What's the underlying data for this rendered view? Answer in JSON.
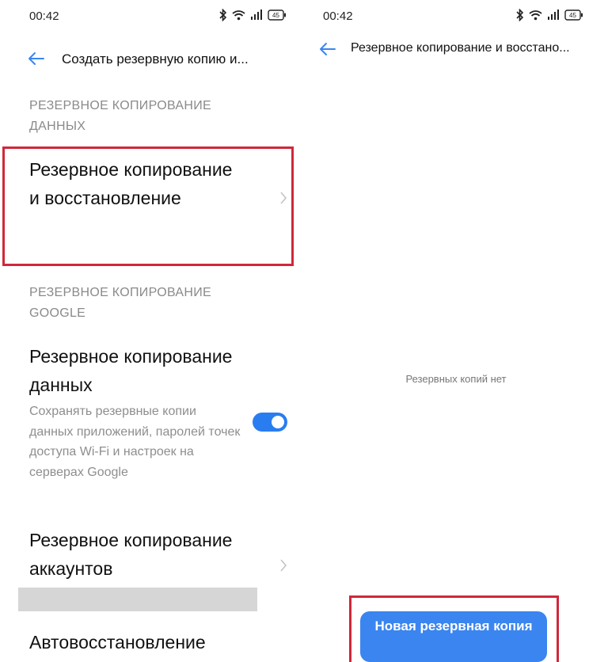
{
  "left_screen": {
    "status": {
      "time": "00:42",
      "battery": "45"
    },
    "title": "Создать резервную копию и...",
    "sections": [
      {
        "header": "РЕЗЕРВНОЕ КОПИРОВАНИЕ ДАННЫХ",
        "items": [
          {
            "title": "Резервное копирование и восстановление"
          }
        ]
      },
      {
        "header": "РЕЗЕРВНОЕ КОПИРОВАНИЕ GOOGLE",
        "items": [
          {
            "title": "Резервное копирование данных",
            "subtitle": "Сохранять резервные копии данных приложений, паролей точек доступа Wi-Fi и настроек на серверах Google",
            "toggle": true
          },
          {
            "title": "Резервное копирование аккаунтов"
          },
          {
            "title": "Автовосстановление"
          }
        ]
      }
    ]
  },
  "right_screen": {
    "status": {
      "time": "00:42",
      "battery": "45"
    },
    "title": "Резервное копирование и восстано...",
    "empty_text": "Резервных копий нет",
    "new_backup_label": "Новая резервная копия"
  },
  "colors": {
    "accent": "#2a7df0",
    "highlight": "#d0283a",
    "secondary_text": "#8a8a8a"
  }
}
